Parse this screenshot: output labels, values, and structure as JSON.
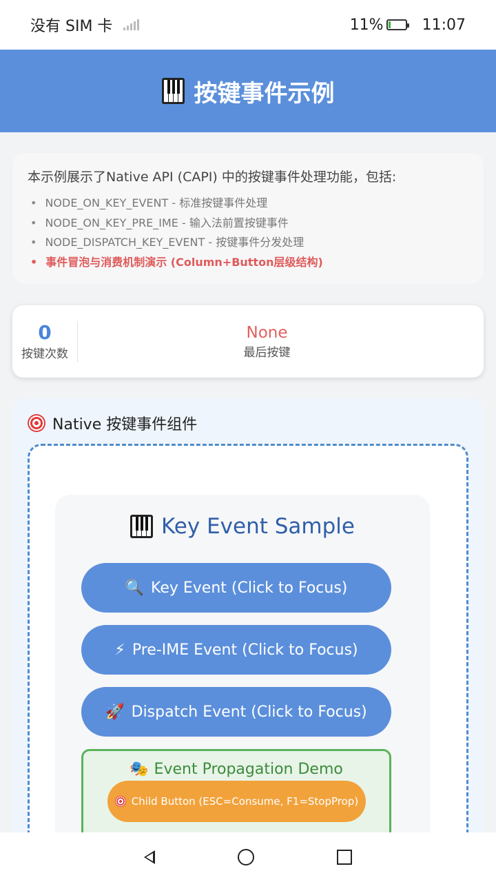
{
  "status_bar": {
    "carrier": "没有 SIM 卡",
    "battery_percent": "11%",
    "battery_level": 0.11,
    "time": "11:07"
  },
  "header": {
    "icon": "piano-icon",
    "title": "按键事件示例",
    "bg_color": "#5b8fdb"
  },
  "info": {
    "intro": "本示例展示了Native API (CAPI) 中的按键事件处理功能，包括:",
    "items": [
      "NODE_ON_KEY_EVENT - 标准按键事件处理",
      "NODE_ON_KEY_PRE_IME - 输入法前置按键事件",
      "NODE_DISPATCH_KEY_EVENT - 按键事件分发处理",
      "事件冒泡与消费机制演示 (Column+Button层级结构)"
    ],
    "bullet": "•"
  },
  "stats": {
    "count_value": "0",
    "count_label": "按键次数",
    "last_value": "None",
    "last_label": "最后按键"
  },
  "native_section": {
    "icon": "target-icon",
    "title": "Native 按键事件组件",
    "sample": {
      "icon": "piano-icon",
      "title": "Key Event Sample",
      "buttons": [
        {
          "icon": "magnifier-icon",
          "glyph": "🔍",
          "label": "Key Event (Click to Focus)"
        },
        {
          "icon": "lightning-icon",
          "glyph": "⚡",
          "label": "Pre-IME Event (Click to Focus)"
        },
        {
          "icon": "rocket-icon",
          "glyph": "🚀",
          "label": "Dispatch Event (Click to Focus)"
        }
      ],
      "propagation": {
        "icon": "theater-masks-icon",
        "glyph": "🎭",
        "title": "Event Propagation Demo",
        "child_button": {
          "icon": "target-icon",
          "label": "Child Button (ESC=Consume, F1=StopProp)"
        }
      }
    }
  },
  "nav_bar": {
    "back": "back-icon",
    "home": "home-icon",
    "recent": "recent-apps-icon"
  }
}
